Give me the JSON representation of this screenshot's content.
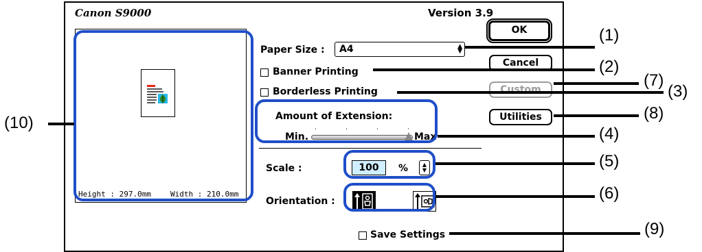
{
  "dialog": {
    "brand": "Canon S9000",
    "version": "Version 3.9",
    "paper_size_label": "Paper Size :",
    "paper_size_value": "A4",
    "banner_label": "Banner Printing",
    "borderless_label": "Borderless Printing",
    "extension_label": "Amount of Extension:",
    "min_label": "Min.",
    "max_label": "Max",
    "scale_label": "Scale :",
    "scale_value": "100",
    "percent": "%",
    "orientation_label": "Orientation :",
    "save_label": "Save Settings",
    "height_label": "Height : 297.0mm",
    "width_label": "Width : 210.0mm",
    "buttons": {
      "ok": "OK",
      "cancel": "Cancel",
      "custom": "Custom",
      "utilities": "Utilities"
    },
    "extension_level": 1.0,
    "orientation_selected": "portrait"
  },
  "callouts": [
    "(1)",
    "(2)",
    "(7)",
    "(3)",
    "(8)",
    "(4)",
    "(5)",
    "(6)",
    "(9)",
    "(10)"
  ],
  "colors": {
    "callout_outline": "#1f4ec8",
    "scale_field": "#cfeeff",
    "disabled_text": "#9c9c9c"
  }
}
